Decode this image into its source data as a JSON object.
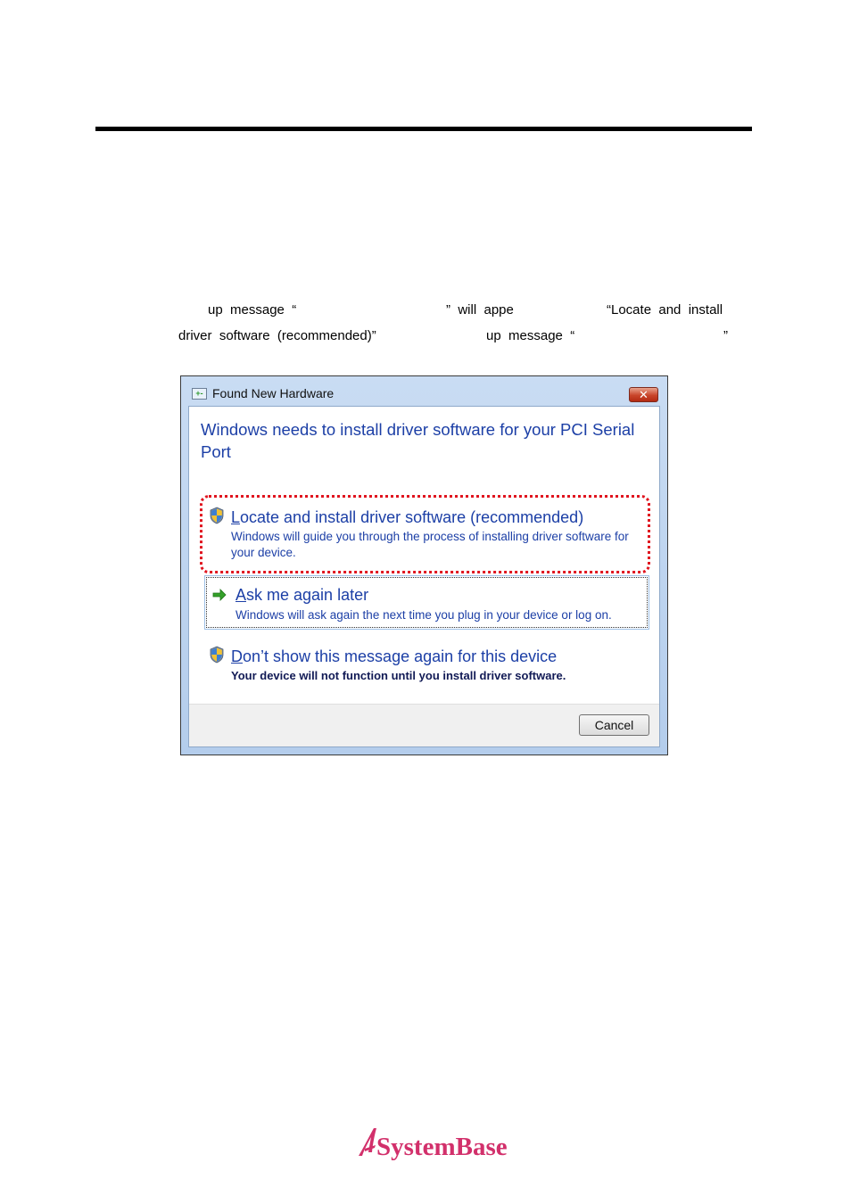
{
  "body_text": {
    "line1": [
      "up  message  “",
      "”  will  appe",
      "“Locate  and  install"
    ],
    "line2": [
      "driver  software  (recommended)”",
      "up  message  “",
      "”"
    ]
  },
  "dialog": {
    "title": "Found New Hardware",
    "close_symbol": "✕",
    "heading": "Windows needs to install driver software for your PCI Serial Port",
    "options": [
      {
        "accel": "L",
        "title_rest": "ocate and install driver software (recommended)",
        "description": "Windows will guide you through the process of installing driver software for your device.",
        "icon": "shield-icon"
      },
      {
        "accel": "A",
        "title_rest": "sk me again later",
        "description": "Windows will ask again the next time you plug in your device or log on.",
        "icon": "green-arrow-icon"
      },
      {
        "accel": "D",
        "title_rest": "on’t show this message again for this device",
        "description": "Your device will not function until you install driver software.",
        "icon": "shield-icon"
      }
    ],
    "cancel_label": "Cancel",
    "highlight_color": "#e0141f",
    "link_color": "#1c3fa6"
  },
  "footer": {
    "logo_text": "SystemBase",
    "brand_color": "#d2306b"
  }
}
